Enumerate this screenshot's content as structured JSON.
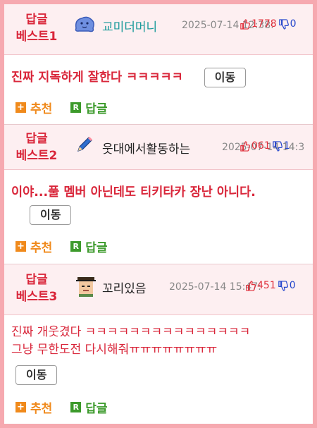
{
  "posts": [
    {
      "best_line1": "답글",
      "best_line2": "베스트1",
      "nickname": "교미더머니",
      "nick_color": "#1a9a9a",
      "date": "2025-07-14 12:38:",
      "up": "1778",
      "down": "0",
      "text": "진짜 지독하게 잘한다 ㅋㅋㅋㅋㅋ",
      "move": "이동",
      "recommend": "추천",
      "reply": "답글",
      "reply_icon": "R"
    },
    {
      "best_line1": "답글",
      "best_line2": "베스트2",
      "nickname": "웃대에서활동하는",
      "nick_color": "#222222",
      "date": "2025-07-14 14:3",
      "up": "061",
      "down": "1",
      "text": "이야...풀 멤버 아닌데도 티키타카 장난 아니다.",
      "move": "이동",
      "recommend": "추천",
      "reply": "답글",
      "reply_icon": "R"
    },
    {
      "best_line1": "답글",
      "best_line2": "베스트3",
      "nickname": "꼬리있음",
      "nick_color": "#222222",
      "date": "2025-07-14 15:47:",
      "up": "451",
      "down": "0",
      "text_line1": "진짜 개웃겼다 ㅋㅋㅋㅋㅋㅋㅋㅋㅋㅋㅋㅋㅋㅋㅋ",
      "text_line2": "그냥 무한도전 다시해줘ㅠㅠㅠㅠㅠㅠㅠㅠ",
      "move": "이동",
      "recommend": "추천",
      "reply": "답글",
      "reply_icon": "R"
    }
  ],
  "plus_icon": "+"
}
